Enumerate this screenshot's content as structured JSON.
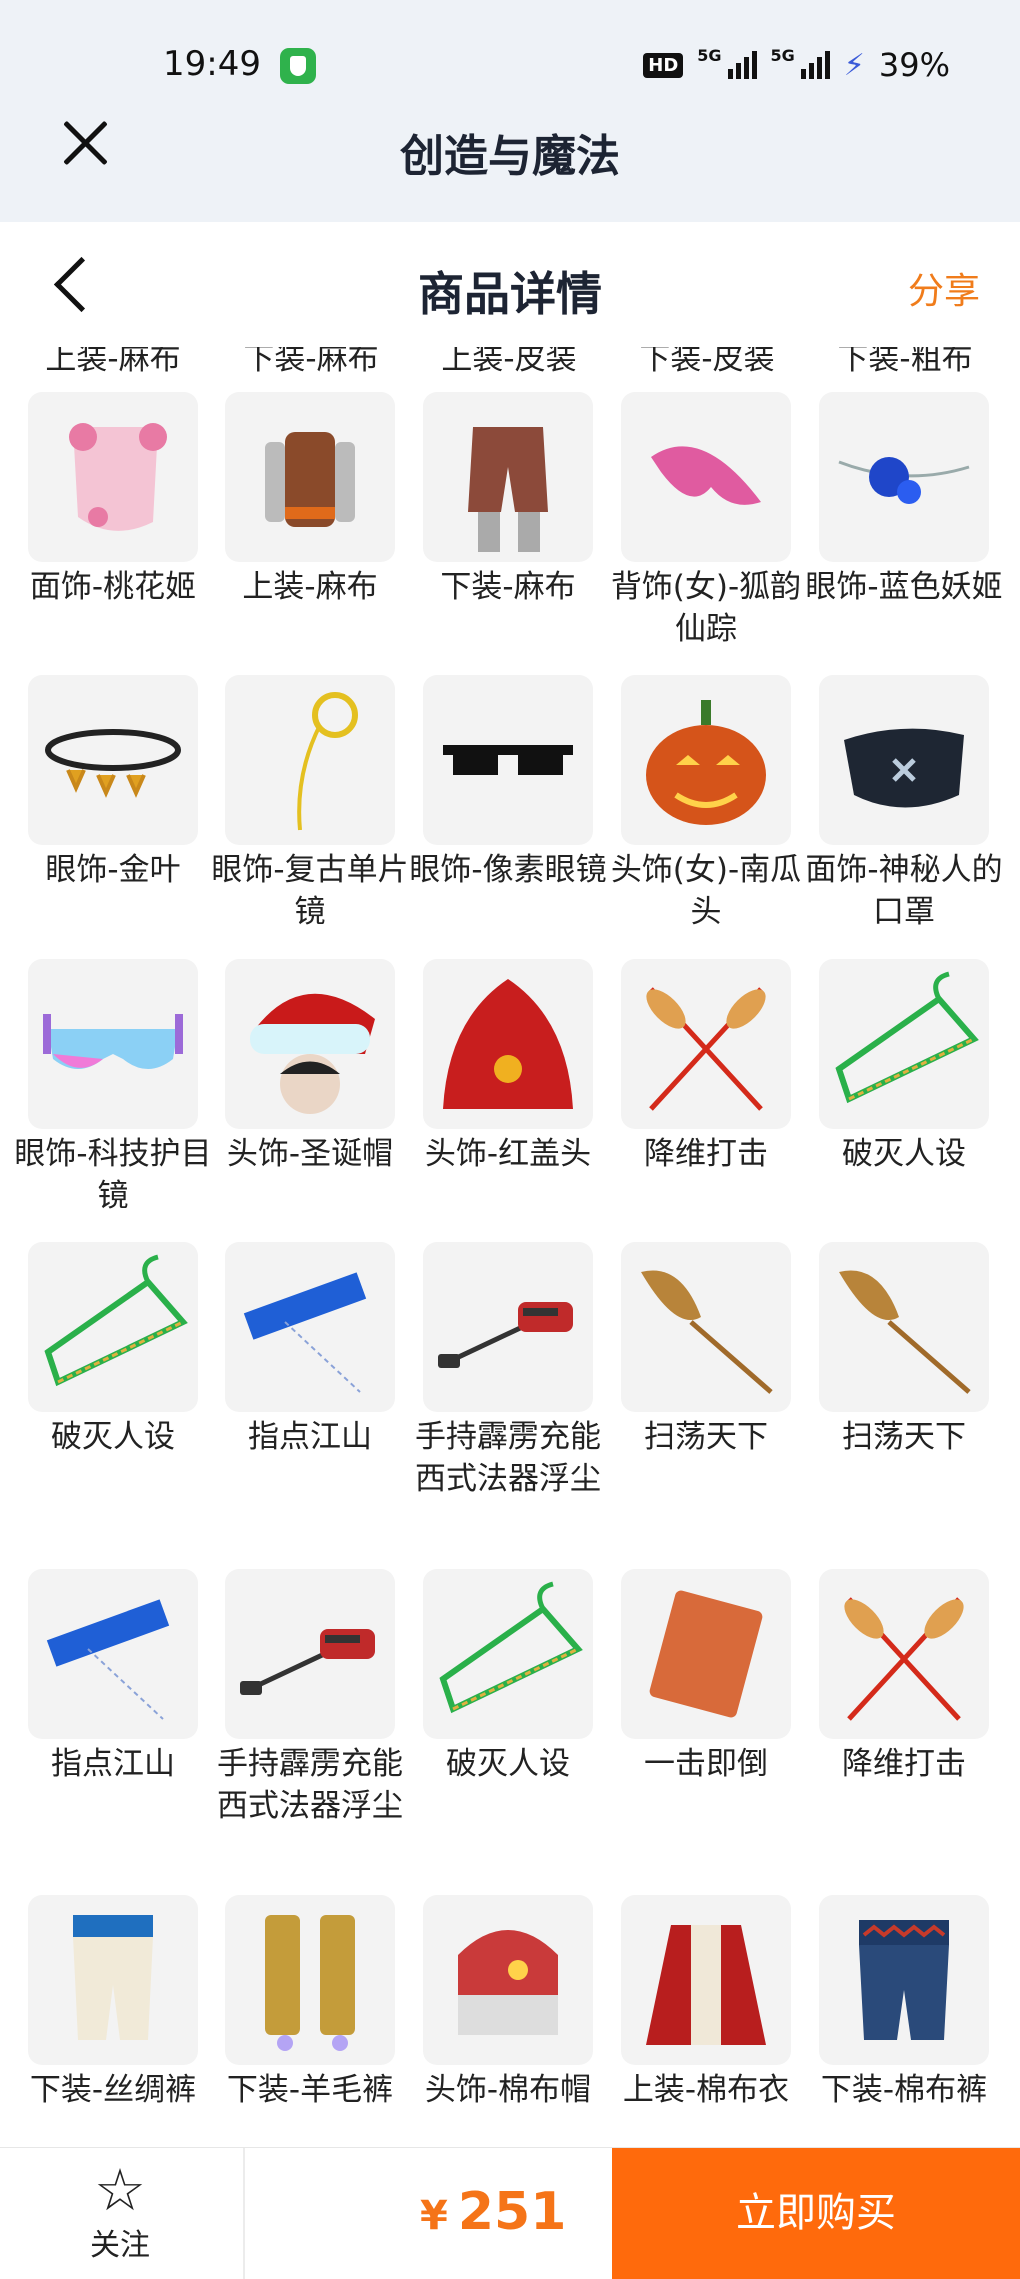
{
  "status_bar": {
    "time": "19:49",
    "hd": "HD",
    "net1": "5G",
    "net2": "5G",
    "battery": "39%"
  },
  "app": {
    "title": "创造与魔法"
  },
  "header": {
    "title": "商品详情",
    "share_label": "分享"
  },
  "cut_row": [
    "上装-麻布",
    "下装-麻布",
    "上装-皮装",
    "下装-皮装",
    "下装-粗布"
  ],
  "items": [
    {
      "name": "面饰-桃花姬",
      "icon": "peach-veil-icon"
    },
    {
      "name": "上装-麻布",
      "icon": "linen-top-icon"
    },
    {
      "name": "下装-麻布",
      "icon": "linen-shorts-icon"
    },
    {
      "name": "背饰(女)-狐韵仙踪",
      "icon": "fox-tail-icon"
    },
    {
      "name": "眼饰-蓝色妖姬",
      "icon": "blue-rose-icon"
    },
    {
      "name": "眼饰-金叶",
      "icon": "gold-leaf-band-icon"
    },
    {
      "name": "眼饰-复古单片镜",
      "icon": "monocle-icon"
    },
    {
      "name": "眼饰-像素眼镜",
      "icon": "pixel-glasses-icon"
    },
    {
      "name": "头饰(女)-南瓜头",
      "icon": "pumpkin-head-icon"
    },
    {
      "name": "面饰-神秘人的口罩",
      "icon": "mask-icon"
    },
    {
      "name": "眼饰-科技护目镜",
      "icon": "tech-goggles-icon"
    },
    {
      "name": "头饰-圣诞帽",
      "icon": "santa-hat-icon"
    },
    {
      "name": "头饰-红盖头",
      "icon": "red-veil-icon"
    },
    {
      "name": "降维打击",
      "icon": "crossed-wheat-icon"
    },
    {
      "name": "破灭人设",
      "icon": "hanger-icon"
    },
    {
      "name": "破灭人设",
      "icon": "hanger-icon"
    },
    {
      "name": "指点江山",
      "icon": "sign-pointer-icon"
    },
    {
      "name": "手持霹雳充能西式法器浮尘",
      "icon": "vacuum-icon"
    },
    {
      "name": "扫荡天下",
      "icon": "broom-icon"
    },
    {
      "name": "扫荡天下",
      "icon": "broom-icon"
    },
    {
      "name": "指点江山",
      "icon": "sign-pointer-icon"
    },
    {
      "name": "手持霹雳充能西式法器浮尘",
      "icon": "vacuum-icon"
    },
    {
      "name": "破灭人设",
      "icon": "hanger-icon"
    },
    {
      "name": "一击即倒",
      "icon": "brick-icon"
    },
    {
      "name": "降维打击",
      "icon": "crossed-wheat-icon"
    },
    {
      "name": "下装-丝绸裤",
      "icon": "silk-pants-icon"
    },
    {
      "name": "下装-羊毛裤",
      "icon": "wool-boots-icon"
    },
    {
      "name": "头饰-棉布帽",
      "icon": "cotton-hat-icon"
    },
    {
      "name": "上装-棉布衣",
      "icon": "cotton-coat-icon"
    },
    {
      "name": "下装-棉布裤",
      "icon": "cotton-pants-icon"
    }
  ],
  "bottom_bar": {
    "follow_label": "关注",
    "currency": "¥",
    "price": "251",
    "buy_label": "立即购买"
  },
  "colors": {
    "accent": "#ff6a0c",
    "price": "#f57418",
    "share": "#f07c1b"
  }
}
